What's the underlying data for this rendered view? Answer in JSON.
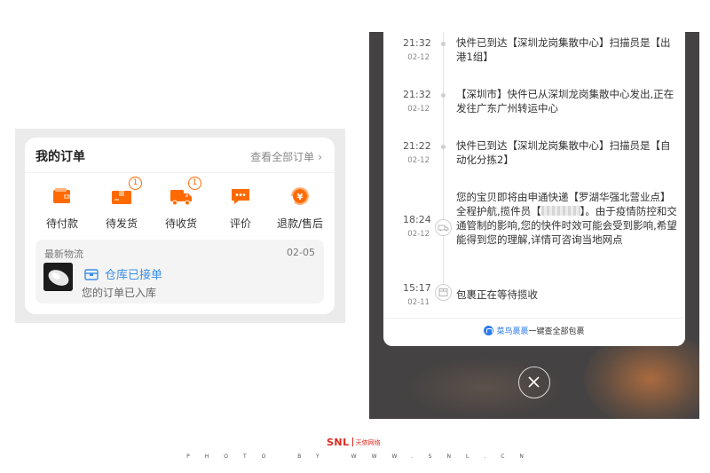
{
  "order_panel": {
    "title": "我的订单",
    "view_all": "查看全部订单",
    "items": [
      {
        "label": "待付款",
        "icon": "wallet-icon",
        "badge": ""
      },
      {
        "label": "待发货",
        "icon": "package-icon",
        "badge": "1"
      },
      {
        "label": "待收货",
        "icon": "delivery-truck-icon",
        "badge": "1"
      },
      {
        "label": "评价",
        "icon": "comment-icon",
        "badge": ""
      },
      {
        "label": "退款/售后",
        "icon": "refund-icon",
        "badge": ""
      }
    ],
    "logistics": {
      "label": "最新物流",
      "date": "02-05",
      "status": "仓库已接单",
      "subtext": "您的订单已入库"
    }
  },
  "timeline": {
    "entries": [
      {
        "time": "21:32",
        "date": "02-12",
        "text": "快件已到达【深圳龙岗集散中心】扫描员是【出港1组】"
      },
      {
        "time": "21:32",
        "date": "02-12",
        "text": "【深圳市】快件已从深圳龙岗集散中心发出,正在发往广东广州转运中心"
      },
      {
        "time": "21:22",
        "date": "02-12",
        "text": "快件已到达【深圳龙岗集散中心】扫描员是【自动化分拣2】"
      },
      {
        "time": "18:24",
        "date": "02-12",
        "text_before": "您的宝贝即将由申通快递【罗湖华强北营业点】全程护航,揽件员【",
        "text_after": "】。由于疫情防控和交通管制的影响,您的快件时效可能会受到影响,希望能得到您的理解,详情可咨询当地网点"
      },
      {
        "time": "15:17",
        "date": "02-11",
        "text": "包裹正在等待揽收"
      }
    ],
    "footer_brand": "菜鸟裹裹",
    "footer_text": "一键查全部包裹"
  },
  "watermark": {
    "logo": "SNL",
    "logo_cn": "天侬网络",
    "photo_credit": "PHOTO BY WWW.SNL.CN"
  },
  "colors": {
    "accent_orange": "#ff6a00",
    "link_blue": "#3a8ee6",
    "cainiao_blue": "#2f7bf0",
    "brand_red": "#e0281e"
  }
}
